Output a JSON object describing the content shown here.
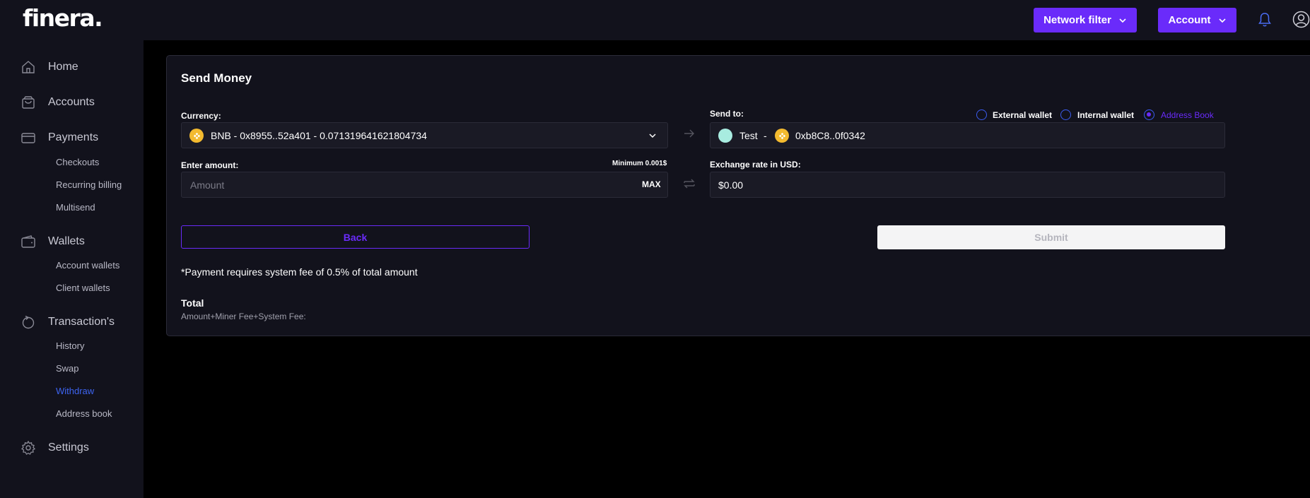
{
  "brand": {
    "logo_text": "finera."
  },
  "header": {
    "network_filter_label": "Network filter",
    "account_label": "Account",
    "bell_icon": "bell-icon",
    "user_icon": "user-circle-icon"
  },
  "sidebar": {
    "home": "Home",
    "accounts": "Accounts",
    "payments": "Payments",
    "checkouts": "Checkouts",
    "recurring_billing": "Recurring billing",
    "multisend": "Multisend",
    "wallets": "Wallets",
    "account_wallets": "Account wallets",
    "client_wallets": "Client wallets",
    "transactions": "Transaction's",
    "history": "History",
    "swap": "Swap",
    "withdraw": "Withdraw",
    "address_book": "Address book",
    "settings": "Settings",
    "active_item": "Withdraw"
  },
  "form": {
    "title": "Send Money",
    "currency_label": "Currency:",
    "currency_value": "BNB - 0x8955..52a401 - 0.071319641621804734",
    "send_to_label": "Send to:",
    "radio_external": "External wallet",
    "radio_internal": "Internal wallet",
    "radio_address_book": "Address Book",
    "selected_radio": "Address Book",
    "recipient_name": "Test",
    "recipient_separator": "-",
    "recipient_address": "0xb8C8..0f0342",
    "enter_amount_label": "Enter amount:",
    "minimum_note": "Minimum 0.001$",
    "amount_placeholder": "Amount",
    "max_label": "MAX",
    "exchange_label": "Exchange rate in USD:",
    "exchange_value": "$0.00",
    "back_label": "Back",
    "submit_label": "Submit",
    "fee_note": "*Payment requires system fee of 0.5% of total amount",
    "total_label": "Total",
    "total_sub": "Amount+Miner Fee+System Fee:"
  },
  "colors": {
    "accent": "#6a2bfa",
    "active_link": "#3d64f0",
    "panel": "#12121c",
    "background": "#000000",
    "coin": "#f3ba2f",
    "recipient_avatar": "#a8ece0"
  }
}
